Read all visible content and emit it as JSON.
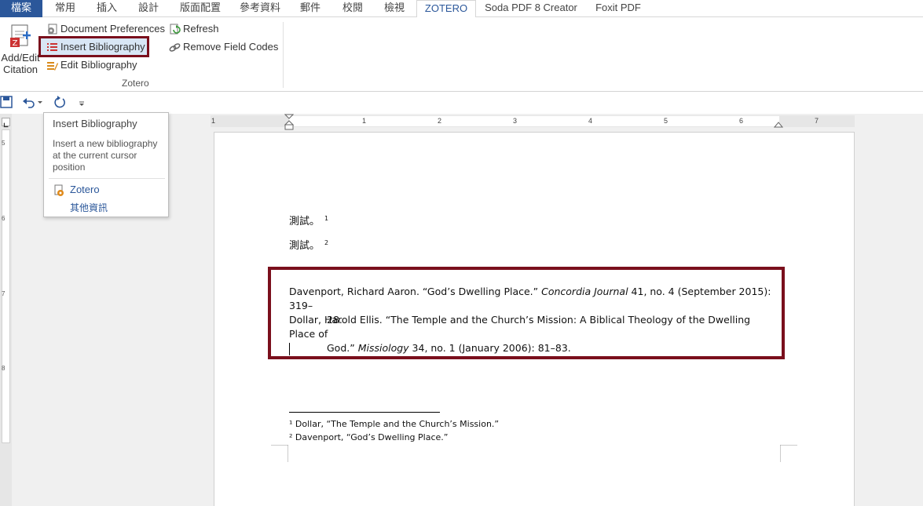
{
  "tabs": [
    {
      "label": "檔案"
    },
    {
      "label": "常用"
    },
    {
      "label": "插入"
    },
    {
      "label": "設計"
    },
    {
      "label": "版面配置"
    },
    {
      "label": "參考資料"
    },
    {
      "label": "郵件"
    },
    {
      "label": "校閱"
    },
    {
      "label": "檢視"
    },
    {
      "label": "ZOTERO"
    },
    {
      "label": "Soda PDF 8 Creator"
    },
    {
      "label": "Foxit PDF"
    }
  ],
  "ribbon": {
    "add_edit_line1": "Add/Edit",
    "add_edit_line2": "Citation",
    "document_preferences": "Document Preferences",
    "insert_bibliography": "Insert Bibliography",
    "edit_bibliography": "Edit Bibliography",
    "refresh": "Refresh",
    "remove_field_codes": "Remove Field Codes",
    "group_label": "Zotero"
  },
  "tooltip": {
    "title": "Insert Bibliography",
    "description": "Insert a new bibliography at the current cursor position",
    "addin": "Zotero",
    "more_info": "其他資訊"
  },
  "ruler": {
    "h_ticks": [
      "1",
      "1",
      "2",
      "3",
      "4",
      "5",
      "6",
      "7"
    ],
    "v_ticks": [
      "5",
      "6",
      "7",
      "8"
    ]
  },
  "document": {
    "line1_text": "測試。",
    "line1_ref": "1",
    "line2_text": "測試。",
    "line2_ref": "2",
    "bib1_a": "Davenport, Richard Aaron. “God’s Dwelling Place.” ",
    "bib1_italic": "Concordia Journal",
    "bib1_b": " 41, no. 4 (September 2015): 319–",
    "bib1_cont": "28.",
    "bib2_a": "Dollar, Harold Ellis. “The Temple and the Church’s Mission: A Biblical Theology of the Dwelling Place of",
    "bib2_cont_a": "God.” ",
    "bib2_italic": "Missiology",
    "bib2_cont_b": " 34, no. 1 (January 2006): 81–83.",
    "footnote1": "¹ Dollar, “The Temple and the Church’s Mission.”",
    "footnote2": "² Davenport, “God’s Dwelling Place.”"
  },
  "colors": {
    "accent": "#2b579a",
    "highlight_border": "#7a0f1c"
  }
}
